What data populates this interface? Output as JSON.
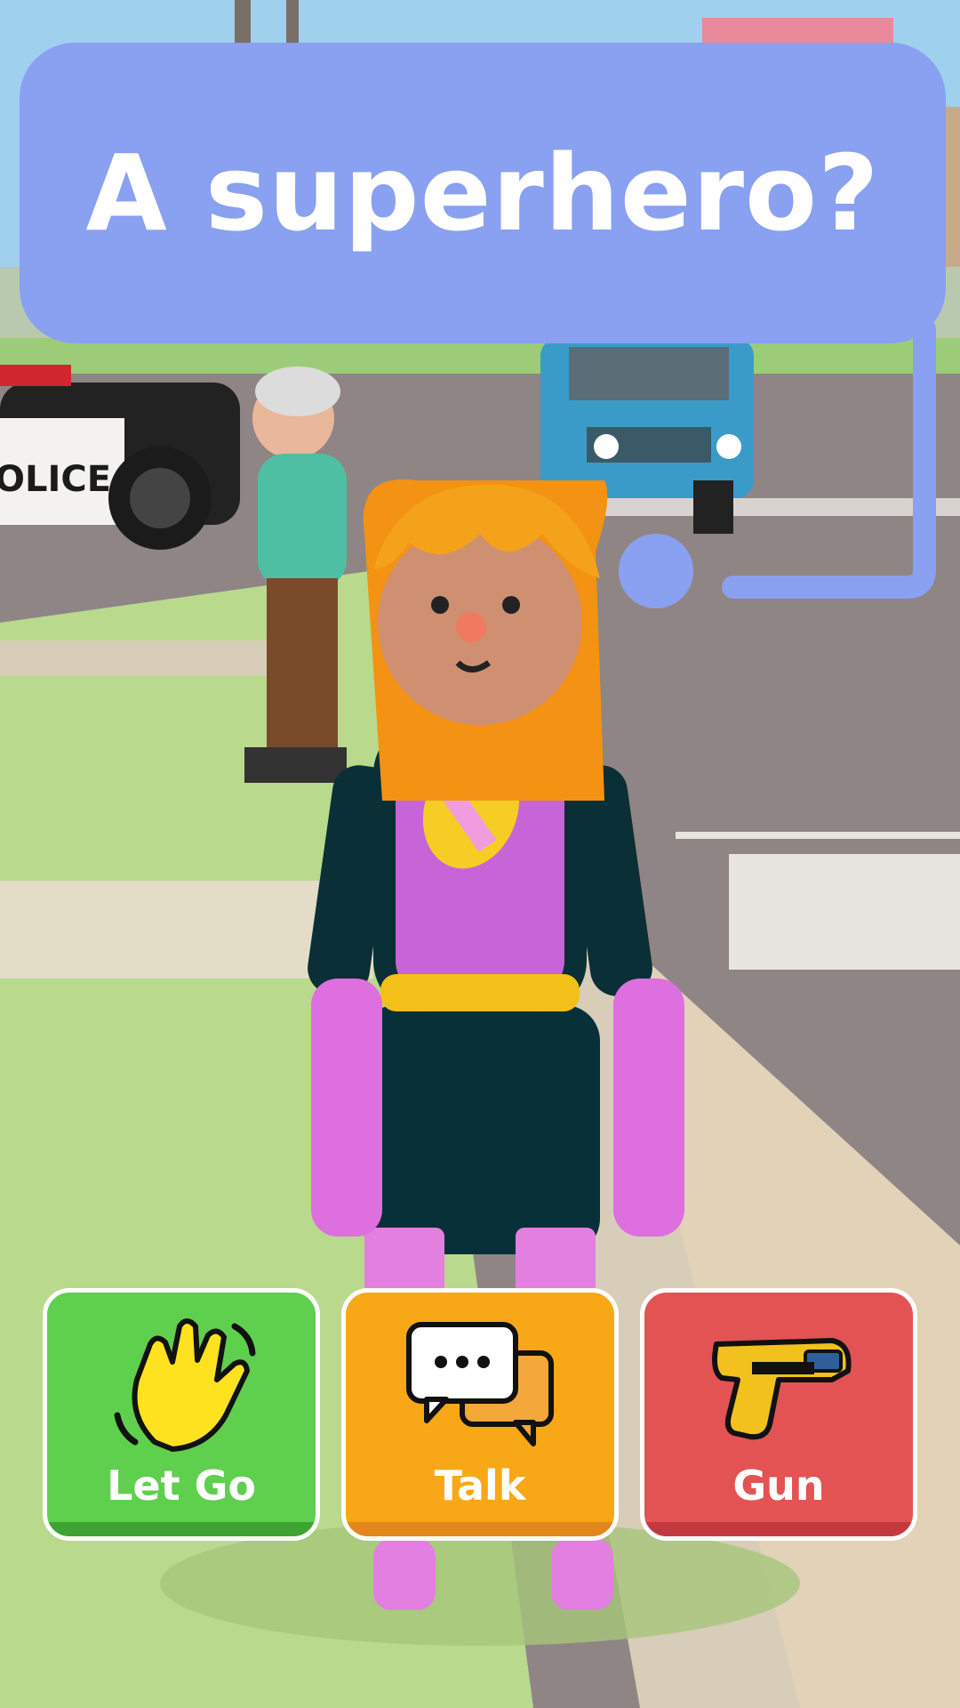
{
  "speech_bubble": {
    "text": "A superhero?"
  },
  "scene": {
    "police_car_text": "OLICE"
  },
  "actions": [
    {
      "label": "Let Go",
      "icon": "waving-hand-icon",
      "color": "#5fcf4e"
    },
    {
      "label": "Talk",
      "icon": "chat-bubbles-icon",
      "color": "#f8a816"
    },
    {
      "label": "Gun",
      "icon": "taser-gun-icon",
      "color": "#e35353"
    }
  ]
}
